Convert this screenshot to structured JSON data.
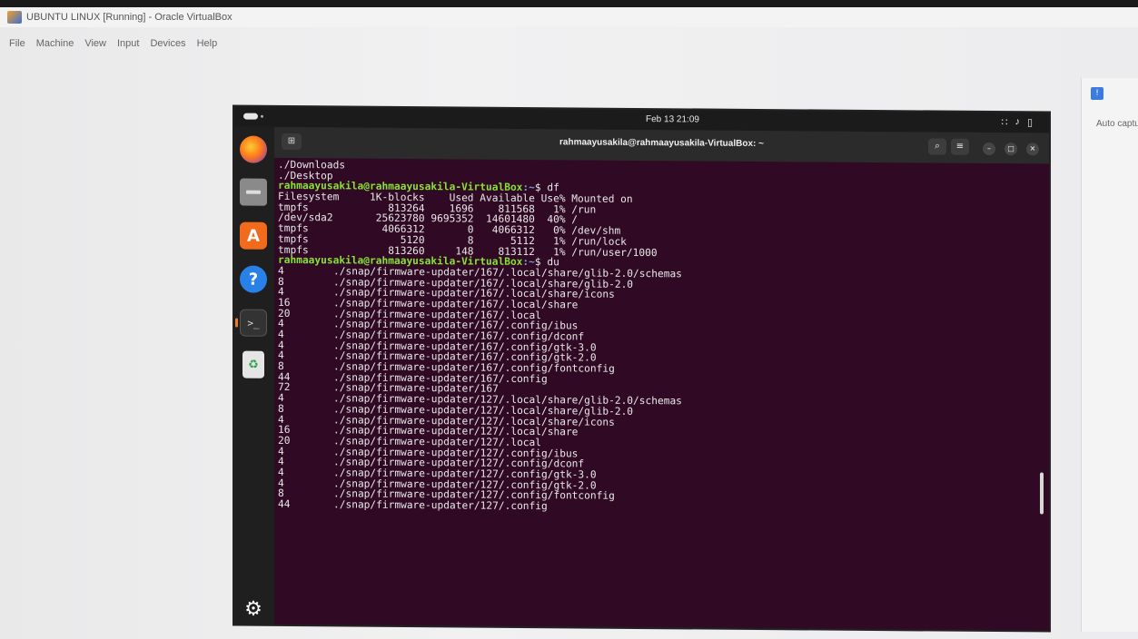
{
  "host": {
    "window_title": "UBUNTU LINUX [Running] - Oracle VirtualBox",
    "menu": [
      "File",
      "Machine",
      "View",
      "Input",
      "Devices",
      "Help"
    ],
    "side_panel_text": "Auto captu"
  },
  "vm": {
    "clock": "Feb 13  21:09",
    "terminal": {
      "title": "rahmaayusakila@rahmaayusakila-VirtualBox: ~",
      "prompt_user": "rahmaayusakila@rahmaayusakila-VirtualBox",
      "prompt_path": ":~",
      "prompt_symbol": "$ ",
      "prelude": [
        "./Downloads",
        "./Desktop"
      ],
      "df_command": "df",
      "df_header": "Filesystem     1K-blocks    Used Available Use% Mounted on",
      "df_rows": [
        "tmpfs             813264    1696    811568   1% /run",
        "/dev/sda2       25623780 9695352  14601480  40% /",
        "tmpfs            4066312       0   4066312   0% /dev/shm",
        "tmpfs               5120       8      5112   1% /run/lock",
        "tmpfs             813260     148    813112   1% /run/user/1000"
      ],
      "du_command": "du",
      "du_rows": [
        {
          "size": "4",
          "path": "./snap/firmware-updater/167/.local/share/glib-2.0/schemas"
        },
        {
          "size": "8",
          "path": "./snap/firmware-updater/167/.local/share/glib-2.0"
        },
        {
          "size": "4",
          "path": "./snap/firmware-updater/167/.local/share/icons"
        },
        {
          "size": "16",
          "path": "./snap/firmware-updater/167/.local/share"
        },
        {
          "size": "20",
          "path": "./snap/firmware-updater/167/.local"
        },
        {
          "size": "4",
          "path": "./snap/firmware-updater/167/.config/ibus"
        },
        {
          "size": "4",
          "path": "./snap/firmware-updater/167/.config/dconf"
        },
        {
          "size": "4",
          "path": "./snap/firmware-updater/167/.config/gtk-3.0"
        },
        {
          "size": "4",
          "path": "./snap/firmware-updater/167/.config/gtk-2.0"
        },
        {
          "size": "8",
          "path": "./snap/firmware-updater/167/.config/fontconfig"
        },
        {
          "size": "44",
          "path": "./snap/firmware-updater/167/.config"
        },
        {
          "size": "72",
          "path": "./snap/firmware-updater/167"
        },
        {
          "size": "4",
          "path": "./snap/firmware-updater/127/.local/share/glib-2.0/schemas"
        },
        {
          "size": "8",
          "path": "./snap/firmware-updater/127/.local/share/glib-2.0"
        },
        {
          "size": "4",
          "path": "./snap/firmware-updater/127/.local/share/icons"
        },
        {
          "size": "16",
          "path": "./snap/firmware-updater/127/.local/share"
        },
        {
          "size": "20",
          "path": "./snap/firmware-updater/127/.local"
        },
        {
          "size": "4",
          "path": "./snap/firmware-updater/127/.config/ibus"
        },
        {
          "size": "4",
          "path": "./snap/firmware-updater/127/.config/dconf"
        },
        {
          "size": "4",
          "path": "./snap/firmware-updater/127/.config/gtk-3.0"
        },
        {
          "size": "4",
          "path": "./snap/firmware-updater/127/.config/gtk-2.0"
        },
        {
          "size": "8",
          "path": "./snap/firmware-updater/127/.config/fontconfig"
        },
        {
          "size": "44",
          "path": "./snap/firmware-updater/127/.config"
        }
      ]
    },
    "dock": [
      {
        "name": "firefox",
        "icon": "firefox-icon"
      },
      {
        "name": "files",
        "icon": "folder-icon"
      },
      {
        "name": "software",
        "icon": "app-center-icon"
      },
      {
        "name": "help",
        "icon": "help-icon"
      },
      {
        "name": "terminal",
        "icon": "terminal-icon"
      },
      {
        "name": "trash",
        "icon": "trash-icon"
      },
      {
        "name": "show-apps",
        "icon": "ubuntu-logo-icon"
      }
    ]
  },
  "colors": {
    "terminal_bg": "#300a24",
    "prompt_user": "#8ae234",
    "prompt_path": "#729fcf"
  }
}
